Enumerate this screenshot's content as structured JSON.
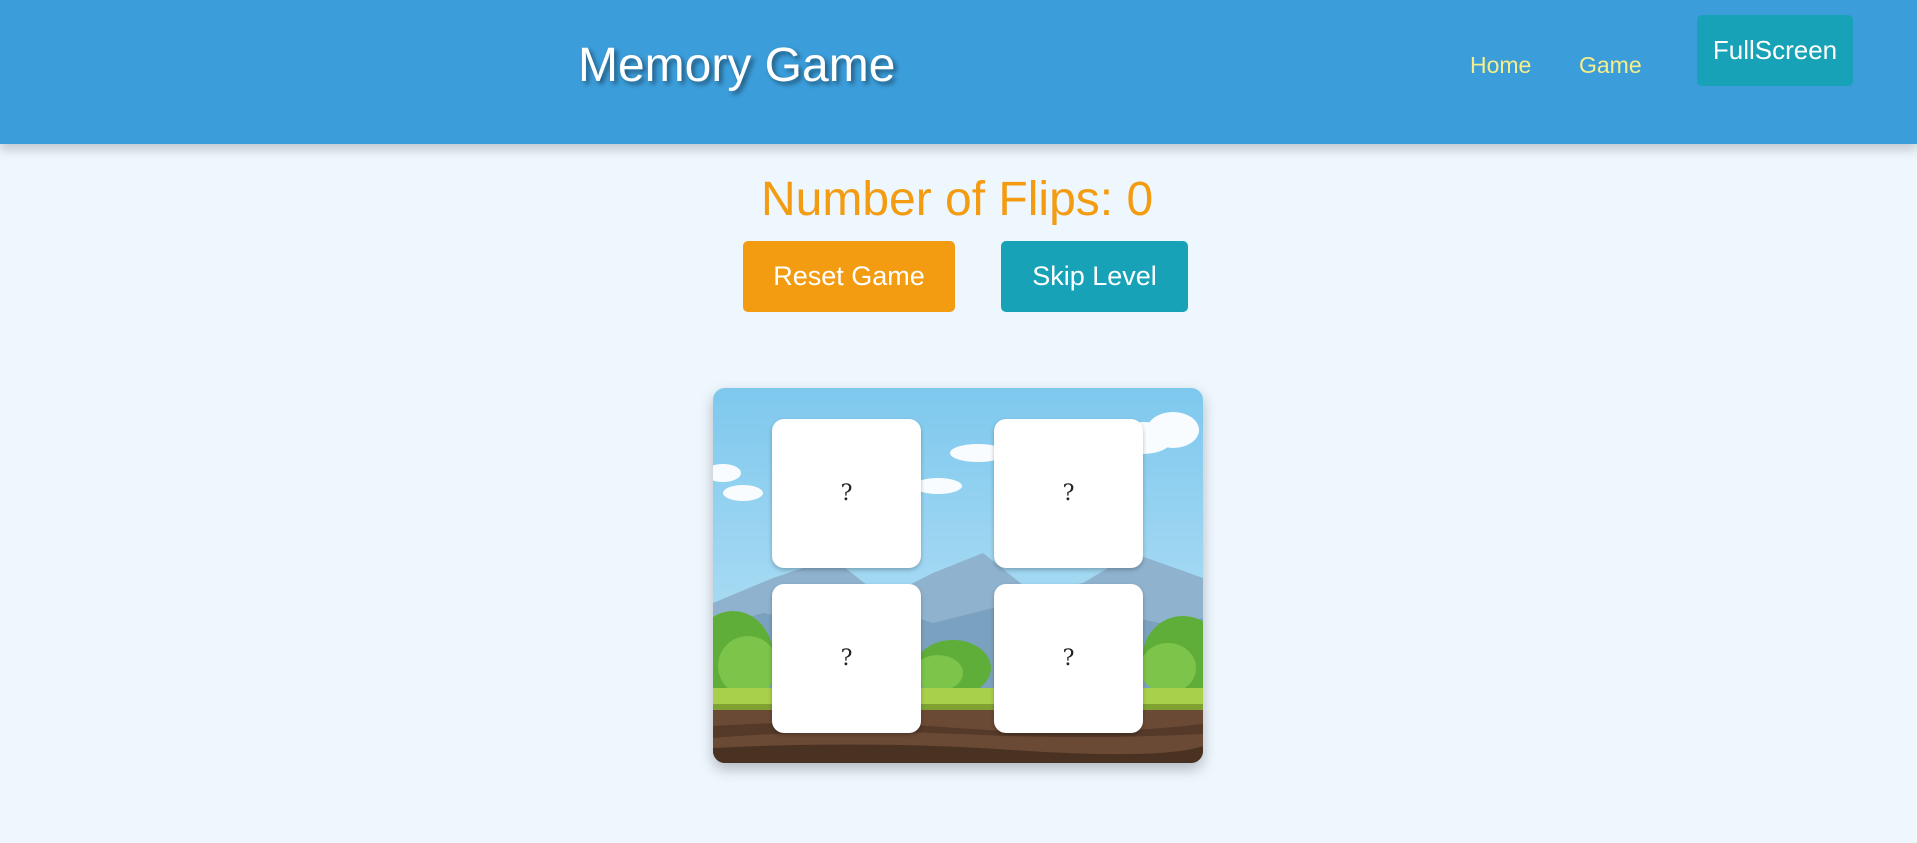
{
  "header": {
    "title": "Memory Game",
    "nav": [
      {
        "label": "Home"
      },
      {
        "label": "Game"
      }
    ],
    "fullscreen_label": "FullScreen"
  },
  "game": {
    "flips_label": "Number of Flips: 0",
    "flips": 0,
    "reset_label": "Reset Game",
    "skip_label": "Skip Level",
    "cards": [
      {
        "face": "?",
        "flipped": false
      },
      {
        "face": "?",
        "flipped": false
      },
      {
        "face": "?",
        "flipped": false
      },
      {
        "face": "?",
        "flipped": false
      }
    ]
  },
  "colors": {
    "header": "#3b9dda",
    "page_bg": "#eef6fe",
    "accent_orange": "#f39c12",
    "accent_teal": "#17a2b8",
    "nav_link": "#f4ef8c"
  }
}
